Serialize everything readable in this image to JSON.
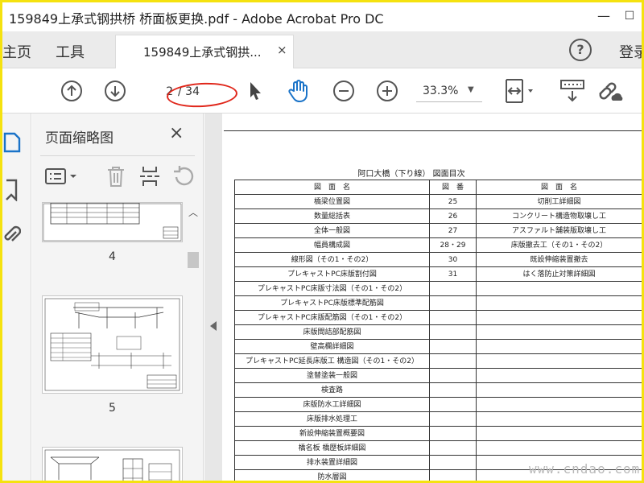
{
  "window": {
    "title": "159849上承式钢拱桥 桥面板更换.pdf - Adobe Acrobat Pro DC"
  },
  "tabs": {
    "home": "主页",
    "tools": "工具",
    "document": "159849上承式钢拱...",
    "document_close": "×",
    "login": "登录"
  },
  "toolbar": {
    "page_current": "2",
    "page_total": "/ 34",
    "zoom": "33.3%"
  },
  "thumbnail_panel": {
    "title": "页面缩略图",
    "close": "×",
    "thumbnails": [
      {
        "label": "4"
      },
      {
        "label": "5"
      },
      {
        "label": ""
      }
    ]
  },
  "document": {
    "title": "阿口大橋（下り線） 図面目次",
    "headers": [
      "図　面　名",
      "図　番",
      "図　面　名"
    ],
    "rows": [
      [
        "橋梁位置図",
        "25",
        "切削工詳細図"
      ],
      [
        "数量総括表",
        "26",
        "コンクリート構造物取壊し工"
      ],
      [
        "全体一般図",
        "27",
        "アスファルト舗装版取壊し工"
      ],
      [
        "幅員構成図",
        "28・29",
        "床版撤去工（その1・その2）"
      ],
      [
        "線形図（その1・その2）",
        "30",
        "既設伸縮装置撤去"
      ],
      [
        "プレキャストPC床版割付図",
        "31",
        "はく落防止対策詳細図"
      ],
      [
        "プレキャストPC床版寸法図（その1・その2）",
        "",
        ""
      ],
      [
        "プレキャストPC床版標準配筋図",
        "",
        ""
      ],
      [
        "プレキャストPC床版配筋図（その1・その2）",
        "",
        ""
      ],
      [
        "床版間詰部配筋図",
        "",
        ""
      ],
      [
        "壁高欄詳細図",
        "",
        ""
      ],
      [
        "プレキャストPC延長床版工 構造図（その1・その2）",
        "",
        ""
      ],
      [
        "塗替塗装一般図",
        "",
        ""
      ],
      [
        "検査路",
        "",
        ""
      ],
      [
        "床版防水工詳細図",
        "",
        ""
      ],
      [
        "床版排水処理工",
        "",
        ""
      ],
      [
        "新設伸縮装置概要図",
        "",
        ""
      ],
      [
        "橋名板 橋歴板詳細図",
        "",
        ""
      ],
      [
        "排水装置詳細図",
        "",
        ""
      ],
      [
        "防水層図",
        "",
        ""
      ]
    ]
  },
  "watermark": "www.cndao.com",
  "icons": {
    "scroll_up": "chevron-up-icon",
    "collapse": "caret-left-icon"
  },
  "colors": {
    "border_frame": "#f5e20f",
    "annotation_ellipse": "#e0261a",
    "accent_blue": "#1a73c8"
  }
}
